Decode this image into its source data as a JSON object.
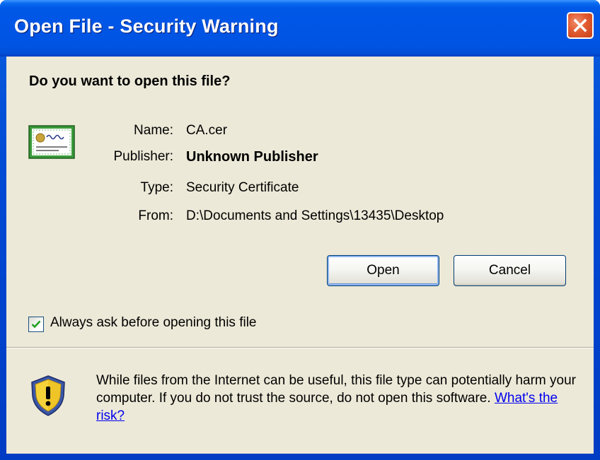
{
  "window": {
    "title": "Open File - Security Warning"
  },
  "dialog": {
    "question": "Do you want to open this file?",
    "fields": {
      "name_label": "Name:",
      "name_value": "CA.cer",
      "publisher_label": "Publisher:",
      "publisher_value": "Unknown Publisher",
      "type_label": "Type:",
      "type_value": "Security Certificate",
      "from_label": "From:",
      "from_value": "D:\\Documents and Settings\\13435\\Desktop"
    },
    "buttons": {
      "open_label": "Open",
      "cancel_label": "Cancel"
    },
    "always_ask": {
      "label": "Always ask before opening this file",
      "checked": true
    },
    "warning": {
      "text": "While files from the Internet can be useful, this file type can potentially harm your computer. If you do not trust the source, do not open this software.",
      "link_text": "What's the risk?"
    }
  },
  "icons": {
    "file_icon": "certificate-icon",
    "warning_icon": "shield-warning-icon",
    "close_icon": "close-icon"
  },
  "colors": {
    "titlebar": "#0055e5",
    "dialog_background": "#ece9d8",
    "close_button": "#e25b30",
    "link": "#0000ee"
  }
}
